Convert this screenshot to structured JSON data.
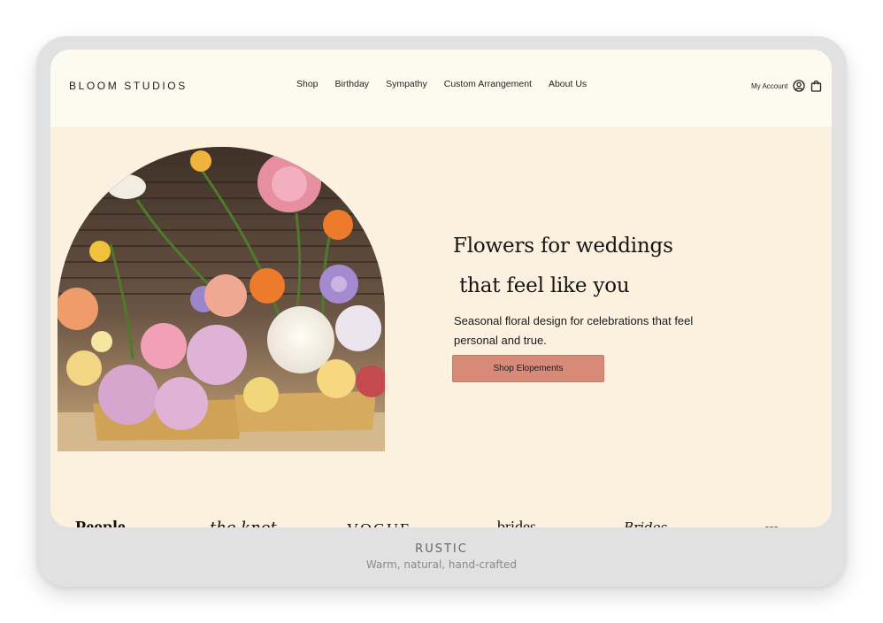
{
  "header": {
    "brand": "BLOOM STUDIOS",
    "nav": [
      "Shop",
      "Birthday",
      "Sympathy",
      "Custom Arrangement",
      "About Us"
    ],
    "account_label": "My Account",
    "account_icon": "user-circle-icon",
    "cart_icon": "shopping-bag-icon"
  },
  "hero": {
    "image_alt": "flower-arrangement-photo",
    "headline_line1": "Flowers for weddings",
    "headline_line2": " that feel like you",
    "subtext": "Seasonal floral design for celebrations that feel personal and true.",
    "cta": "Shop Elopements"
  },
  "press": {
    "logos": [
      "People",
      "the knot",
      "VOGUE",
      "brides",
      "Brides",
      "logo"
    ]
  },
  "caption": {
    "title": "RUSTIC",
    "subtitle": "Warm, natural, hand-crafted"
  },
  "colors": {
    "header_bg": "#fdfbf0",
    "page_bg": "#fcf0de",
    "cta_bg": "#d88a78",
    "frame": "#e1e1e1"
  }
}
